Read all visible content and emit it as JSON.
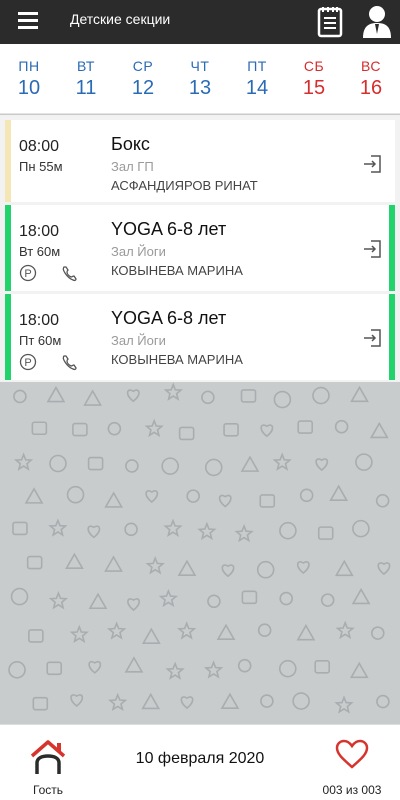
{
  "header": {
    "title": "Детские секции",
    "background": "#2b2b2b"
  },
  "week": [
    {
      "name": "ПН",
      "num": "10",
      "weekend": false
    },
    {
      "name": "ВТ",
      "num": "11",
      "weekend": false
    },
    {
      "name": "СР",
      "num": "12",
      "weekend": false
    },
    {
      "name": "ЧТ",
      "num": "13",
      "weekend": false
    },
    {
      "name": "ПТ",
      "num": "14",
      "weekend": false
    },
    {
      "name": "СБ",
      "num": "15",
      "weekend": true
    },
    {
      "name": "ВС",
      "num": "16",
      "weekend": true
    }
  ],
  "colors": {
    "weekday": "#2a6bb5",
    "weekend": "#d62d2d",
    "accent_home": "#d6342c",
    "accent_heart": "#d6342c",
    "card_box_stripe": "#f5e6b5",
    "card_yoga_stripe": "#22d36b"
  },
  "classes": [
    {
      "time": "08:00",
      "day_duration": "Пн 55м",
      "name": "Бокс",
      "hall": "Зал ГП",
      "trainer": "АСФАНДИЯРОВ РИНАТ",
      "stripe": "#f5e6b5",
      "icons": []
    },
    {
      "time": "18:00",
      "day_duration": "Вт  60м",
      "name": "YOGA 6-8 лет",
      "hall": "Зал Йоги",
      "trainer": "КОВЫНЕВА МАРИНА",
      "stripe": "#22d36b",
      "icons": [
        "parking-icon",
        "phone-icon"
      ]
    },
    {
      "time": "18:00",
      "day_duration": "Пт  60м",
      "name": "YOGA 6-8 лет",
      "hall": "Зал Йоги",
      "trainer": "КОВЫНЕВА МАРИНА",
      "stripe": "#22d36b",
      "icons": [
        "parking-icon",
        "phone-icon"
      ]
    }
  ],
  "footer": {
    "home_label": "Гость",
    "date": "10 февраля 2020",
    "counter": "003 из 003",
    "home_icon": "home-icon",
    "favorite_icon": "heart-icon"
  }
}
